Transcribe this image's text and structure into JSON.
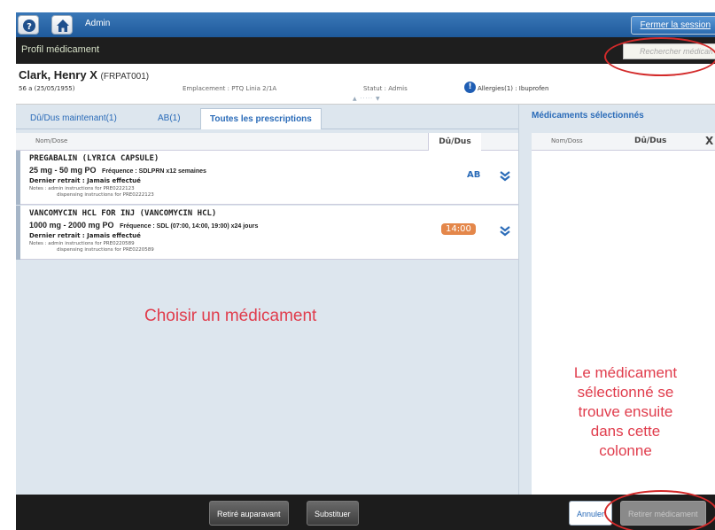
{
  "topbar": {
    "help_icon": "help-icon",
    "home_icon": "home-icon",
    "user_label": "Admin",
    "logout_label": "Fermer la session"
  },
  "titlebar": {
    "title": "Profil médicament",
    "search_placeholder": "Rechercher médicament",
    "clear_symbol": "✕"
  },
  "patient": {
    "name": "Clark, Henry X",
    "id": "(FRPAT001)",
    "age_dob": "56 a (25/05/1955)",
    "location": "Emplacement : PTQ Linia 2/1A",
    "status": "Statut : Admis",
    "allergies": "Allergies(1) : Ibuprofen",
    "info_symbol": "!",
    "expander": "▲ ····· ▼"
  },
  "tabs": [
    {
      "label": "Dû/Dus maintenant(1)",
      "active": false
    },
    {
      "label": "AB(1)",
      "active": false
    },
    {
      "label": "Toutes les prescriptions",
      "active": true
    }
  ],
  "med_list": {
    "header_name": "Nom/Dose",
    "header_due": "Dû/Dus",
    "items": [
      {
        "name": "PREGABALIN (LYRICA CAPSULE)",
        "dose": "25 mg - 50 mg PO",
        "frequency": "Fréquence : SDLPRN x12 semaines",
        "last": "Dernier retrait : Jamais effectué",
        "note1": "Notes :  admin instructions for PRE0222123",
        "note2": "dispensing instructions for PRE0222123",
        "due": "AB"
      },
      {
        "name": "VANCOMYCIN HCL FOR INJ (VANCOMYCIN HCL)",
        "dose": "1000 mg - 2000 mg PO",
        "frequency": "Fréquence : SDL (07:00, 14:00, 19:00) x24 jours",
        "last": "Dernier retrait : Jamais effectué",
        "note1": "Notes :  admin instructions for PRE0220589",
        "note2": "dispensing instructions for PRE0220589",
        "due": "14:00"
      }
    ],
    "expand_icon": "chevron-double-down-icon"
  },
  "annotations": {
    "choose": "Choisir un médicament",
    "selected_line1": "Le médicament",
    "selected_line2": "sélectionné se",
    "selected_line3": "trouve ensuite",
    "selected_line4": "dans cette",
    "selected_line5": "colonne",
    "highlight_color": "#d32a2a"
  },
  "selected_panel": {
    "title": "Médicaments sélectionnés",
    "header_name": "Nom/Doss",
    "header_due": "Dû/Dus",
    "header_remove": "X"
  },
  "footer": {
    "prev_removed": "Retiré auparavant",
    "substitute": "Substituer",
    "cancel": "Annuler",
    "remove": "Retirer médicament"
  },
  "colors": {
    "accent": "#2a6bb8",
    "due_time": "#e4874a",
    "annotation": "#e03c4c"
  }
}
